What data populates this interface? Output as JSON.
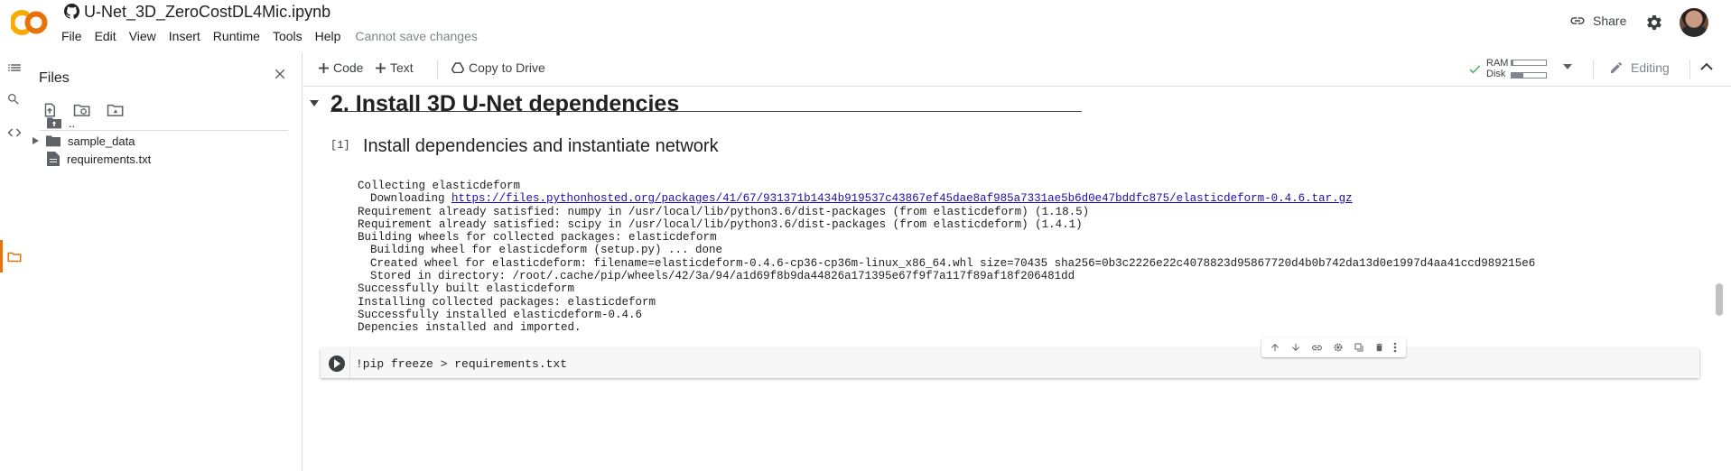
{
  "header": {
    "doc_title": "U-Net_3D_ZeroCostDL4Mic.ipynb",
    "menu": [
      "File",
      "Edit",
      "View",
      "Insert",
      "Runtime",
      "Tools",
      "Help"
    ],
    "save_note": "Cannot save changes",
    "share_label": "Share",
    "logo_text": "CO",
    "brand_color": "#f9ab00"
  },
  "files_panel": {
    "title": "Files",
    "items": [
      {
        "label": "..",
        "icon": "folder-up-icon"
      },
      {
        "label": "sample_data",
        "icon": "folder-icon"
      },
      {
        "label": "requirements.txt",
        "icon": "file-icon"
      }
    ]
  },
  "toolbar": {
    "code_label": "Code",
    "text_label": "Text",
    "drive_label": "Copy to Drive",
    "ram_label": "RAM",
    "disk_label": "Disk",
    "ram_usage": 0.05,
    "disk_usage": 0.35,
    "editing_label": "Editing"
  },
  "notebook": {
    "section_heading": "2. Install 3D U-Net dependencies",
    "cell_count": "[1]",
    "cell_title": "Install dependencies and instantiate network",
    "output": {
      "l1": "Collecting elasticdeform",
      "l2_prefix": "Downloading ",
      "l2_link": "https://files.pythonhosted.org/packages/41/67/931371b1434b919537c43867ef45dae8af985a7331ae5b6d0e47bddfc875/elasticdeform-0.4.6.tar.gz",
      "l3": "Requirement already satisfied: numpy in /usr/local/lib/python3.6/dist-packages (from elasticdeform) (1.18.5)",
      "l4": "Requirement already satisfied: scipy in /usr/local/lib/python3.6/dist-packages (from elasticdeform) (1.4.1)",
      "l5": "Building wheels for collected packages: elasticdeform",
      "l6": "Building wheel for elasticdeform (setup.py) ... done",
      "l7": "Created wheel for elasticdeform: filename=elasticdeform-0.4.6-cp36-cp36m-linux_x86_64.whl size=70435 sha256=0b3c2226e22c4078823d95867720d4b0b742da13d0e1997d4aa41ccd989215e6",
      "l8": "Stored in directory: /root/.cache/pip/wheels/42/3a/94/a1d69f8b9da44826a171395e67f9f7a117f89af18f206481dd",
      "l9": "Successfully built elasticdeform",
      "l10": "Installing collected packages: elasticdeform",
      "l11": "Successfully installed elasticdeform-0.4.6",
      "l12": "Depencies installed and imported."
    },
    "code_cell": "!pip freeze > requirements.txt"
  }
}
